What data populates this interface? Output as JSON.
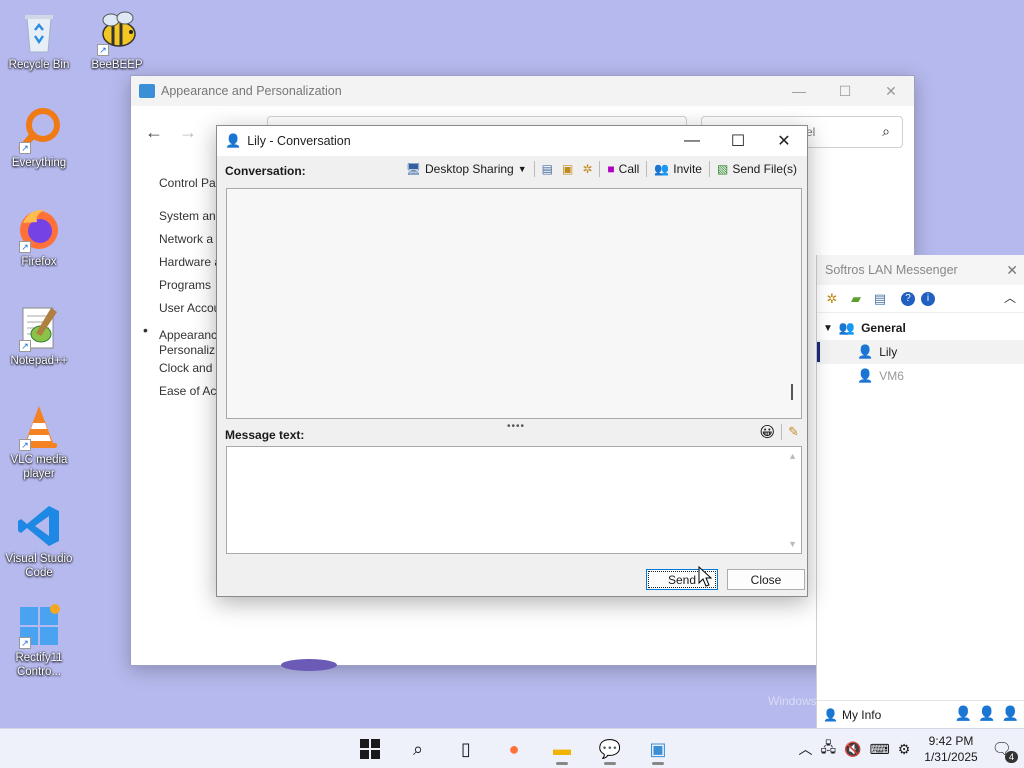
{
  "desktop": {
    "icons": [
      {
        "label": "Recycle Bin"
      },
      {
        "label": "BeeBEEP"
      },
      {
        "label": "Everything"
      },
      {
        "label": "Firefox"
      },
      {
        "label": "Notepad++"
      },
      {
        "label": "VLC media player"
      },
      {
        "label": "Visual Studio Code"
      },
      {
        "label": "Rectify11 Contro..."
      }
    ]
  },
  "control_panel": {
    "title": "Appearance and Personalization",
    "search_placeholder": "el",
    "nav_items": [
      "Control Pa",
      "System an",
      "Network a",
      "Hardware a",
      "Programs",
      "User Accou",
      "Appearanc",
      "Personaliz",
      "Clock and",
      "Ease of Ac"
    ]
  },
  "conversation": {
    "title": "Lily - Conversation",
    "conversation_label": "Conversation:",
    "toolbar": {
      "desktop_sharing": "Desktop Sharing",
      "call": "Call",
      "invite": "Invite",
      "send_files": "Send File(s)"
    },
    "message_label": "Message text:",
    "message_value": "",
    "send_label": "Send",
    "close_label": "Close"
  },
  "messenger": {
    "title": "Softros LAN Messenger",
    "group": "General",
    "users": [
      {
        "name": "Lily",
        "status": "online"
      },
      {
        "name": "VM6",
        "status": "offline"
      }
    ],
    "my_info": "My Info"
  },
  "watermark": "Windows",
  "taskbar": {
    "time": "9:42 PM",
    "date": "1/31/2025",
    "notification_count": "4"
  }
}
